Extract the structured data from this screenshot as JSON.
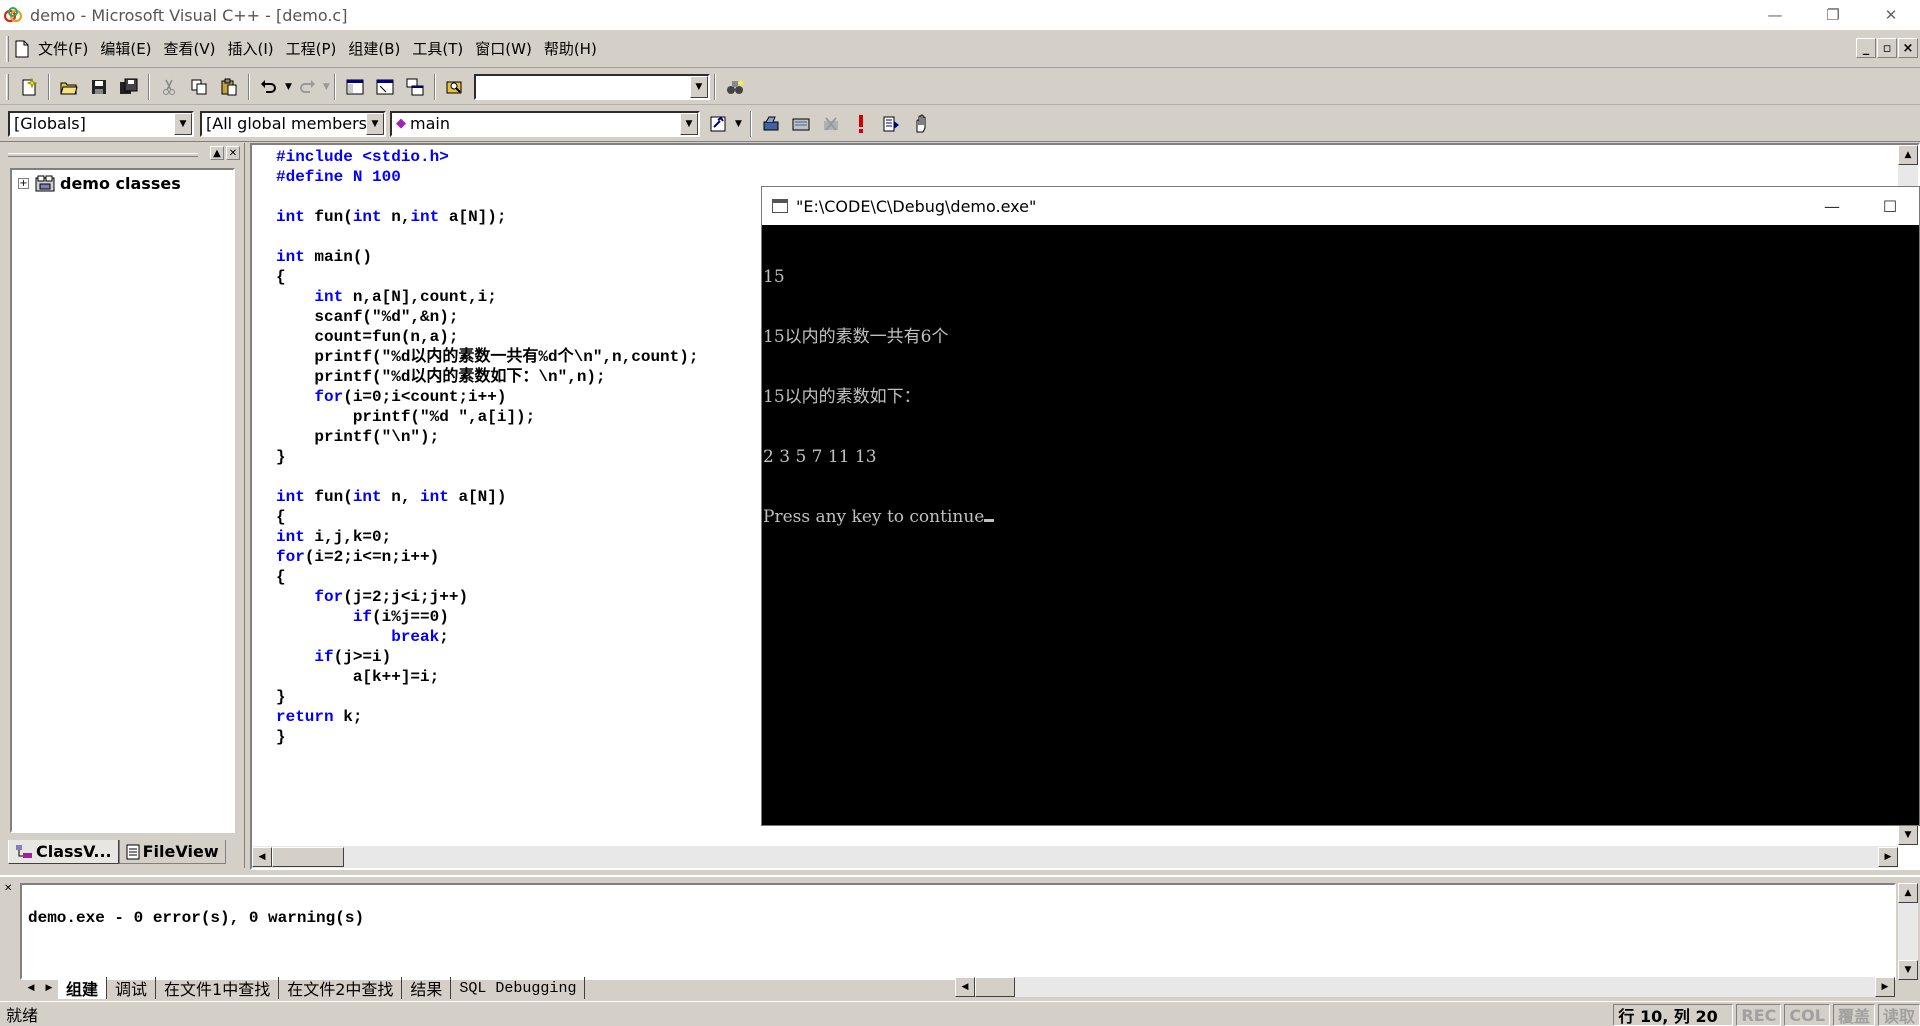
{
  "window": {
    "title": "demo - Microsoft Visual C++ - [demo.c]",
    "controls": [
      "—",
      "❐",
      "✕"
    ]
  },
  "menu": {
    "items": [
      "文件(F)",
      "编辑(E)",
      "查看(V)",
      "插入(I)",
      "工程(P)",
      "组建(B)",
      "工具(T)",
      "窗口(W)",
      "帮助(H)"
    ],
    "mdi_controls": [
      "_",
      "▫",
      "×"
    ]
  },
  "toolbar": {
    "find_combo_value": ""
  },
  "wizard_bar": {
    "scope": "[Globals]",
    "filter": "[All global members",
    "function": "main"
  },
  "workspace": {
    "tree_root": "demo classes",
    "tabs": [
      "ClassV...",
      "FileView"
    ]
  },
  "editor": {
    "lines": [
      [
        [
          "pp",
          "#include <stdio.h>"
        ]
      ],
      [
        [
          "pp",
          "#define N 100"
        ]
      ],
      [],
      [
        [
          "kw",
          "int"
        ],
        [
          "t",
          " fun("
        ],
        [
          "kw",
          "int"
        ],
        [
          "t",
          " n,"
        ],
        [
          "kw",
          "int"
        ],
        [
          "t",
          " a[N]);"
        ]
      ],
      [],
      [
        [
          "kw",
          "int"
        ],
        [
          "t",
          " main()"
        ]
      ],
      [
        [
          "t",
          "{"
        ]
      ],
      [
        [
          "t",
          "    "
        ],
        [
          "kw",
          "int"
        ],
        [
          "t",
          " n,a[N],count,i;"
        ]
      ],
      [
        [
          "t",
          "    scanf(\"%d\",&n);"
        ]
      ],
      [
        [
          "t",
          "    count=fun(n,a);"
        ]
      ],
      [
        [
          "t",
          "    printf(\"%d以内的素数一共有%d个\\n\",n,count);"
        ]
      ],
      [
        [
          "t",
          "    printf(\"%d以内的素数如下：\\n\",n);"
        ]
      ],
      [
        [
          "t",
          "    "
        ],
        [
          "kw",
          "for"
        ],
        [
          "t",
          "(i=0;i<count;i++)"
        ]
      ],
      [
        [
          "t",
          "        printf(\"%d \",a[i]);"
        ]
      ],
      [
        [
          "t",
          "    printf(\"\\n\");"
        ]
      ],
      [
        [
          "t",
          "}"
        ]
      ],
      [],
      [
        [
          "kw",
          "int"
        ],
        [
          "t",
          " fun("
        ],
        [
          "kw",
          "int"
        ],
        [
          "t",
          " n, "
        ],
        [
          "kw",
          "int"
        ],
        [
          "t",
          " a[N])"
        ]
      ],
      [
        [
          "t",
          "{"
        ]
      ],
      [
        [
          "kw",
          "int"
        ],
        [
          "t",
          " i,j,k=0;"
        ]
      ],
      [
        [
          "kw",
          "for"
        ],
        [
          "t",
          "(i=2;i<=n;i++)"
        ]
      ],
      [
        [
          "t",
          "{"
        ]
      ],
      [
        [
          "t",
          "    "
        ],
        [
          "kw",
          "for"
        ],
        [
          "t",
          "(j=2;j<i;j++)"
        ]
      ],
      [
        [
          "t",
          "        "
        ],
        [
          "kw",
          "if"
        ],
        [
          "t",
          "(i%j==0)"
        ]
      ],
      [
        [
          "t",
          "            "
        ],
        [
          "kw",
          "break"
        ],
        [
          "t",
          ";"
        ]
      ],
      [
        [
          "t",
          "    "
        ],
        [
          "kw",
          "if"
        ],
        [
          "t",
          "(j>=i)"
        ]
      ],
      [
        [
          "t",
          "        a[k++]=i;"
        ]
      ],
      [
        [
          "t",
          "}"
        ]
      ],
      [
        [
          "kw",
          "return"
        ],
        [
          "t",
          " k;"
        ]
      ],
      [
        [
          "t",
          "}"
        ]
      ]
    ]
  },
  "console": {
    "title": "\"E:\\CODE\\C\\Debug\\demo.exe\"",
    "lines": [
      "15",
      "15以内的素数一共有6个",
      "15以内的素数如下：",
      "2 3 5 7 11 13",
      "Press any key to continue"
    ]
  },
  "output": {
    "message": "demo.exe - 0 error(s), 0 warning(s)",
    "tabs": [
      "组建",
      "调试",
      "在文件1中查找",
      "在文件2中查找",
      "结果",
      "SQL Debugging"
    ]
  },
  "status": {
    "text": "就绪",
    "position": "行 10, 列 20",
    "indicators": [
      "REC",
      "COL",
      "覆盖",
      "读取"
    ]
  },
  "colors": {
    "keyword": "#0000ff",
    "chrome": "#d4d0c8",
    "console_bg": "#000000",
    "console_text": "#c0c0c0"
  }
}
